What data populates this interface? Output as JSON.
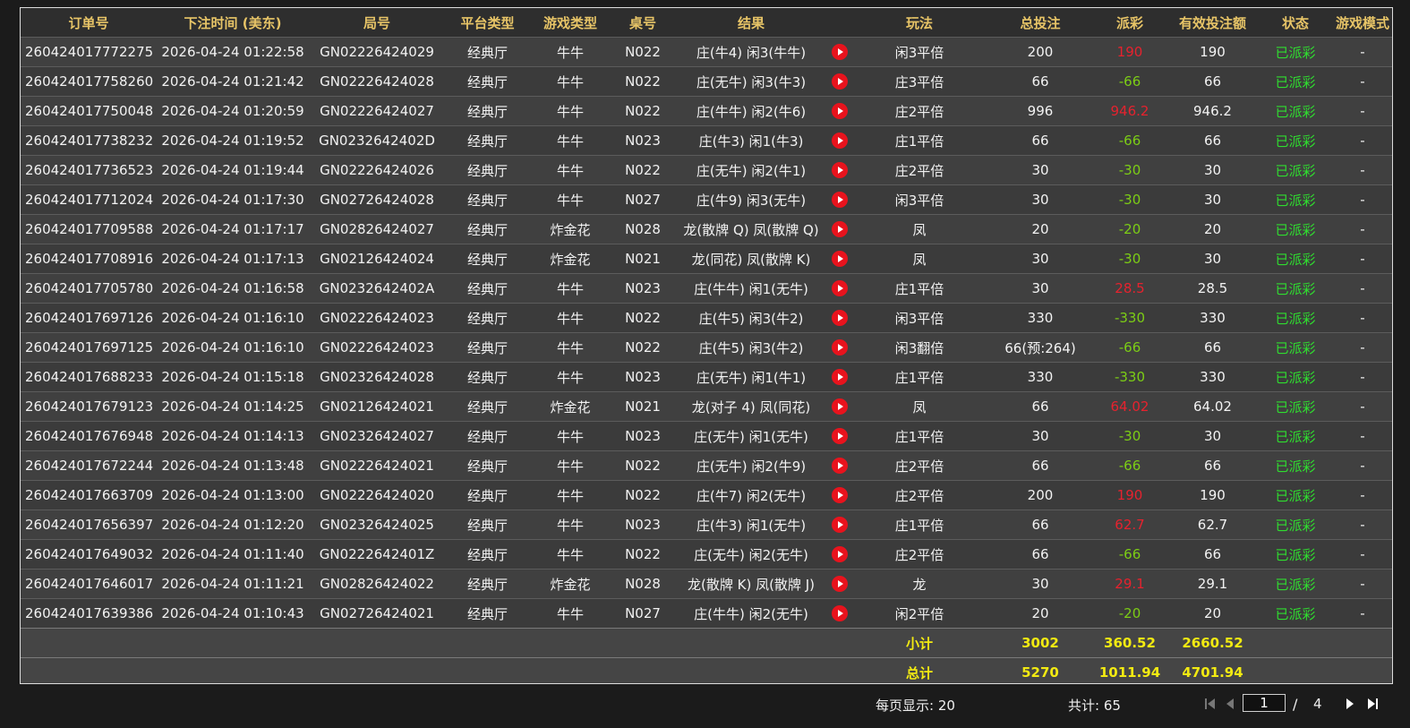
{
  "columns": [
    "订单号",
    "下注时间 (美东)",
    "局号",
    "平台类型",
    "游戏类型",
    "桌号",
    "结果",
    "",
    "玩法",
    "总投注",
    "派彩",
    "有效投注额",
    "状态",
    "游戏模式"
  ],
  "rows": [
    {
      "order": "260424017772275",
      "time": "2026-04-24 01:22:58",
      "round": "GN02226424029",
      "platform": "经典厅",
      "game": "牛牛",
      "table": "N022",
      "result": "庄(牛4) 闲3(牛牛)",
      "play": "闲3平倍",
      "bet": "200",
      "payout": "190",
      "payout_type": "win",
      "valid": "190",
      "status": "已派彩",
      "mode": "-"
    },
    {
      "order": "260424017758260",
      "time": "2026-04-24 01:21:42",
      "round": "GN02226424028",
      "platform": "经典厅",
      "game": "牛牛",
      "table": "N022",
      "result": "庄(无牛) 闲3(牛3)",
      "play": "庄3平倍",
      "bet": "66",
      "payout": "-66",
      "payout_type": "lose",
      "valid": "66",
      "status": "已派彩",
      "mode": "-"
    },
    {
      "order": "260424017750048",
      "time": "2026-04-24 01:20:59",
      "round": "GN02226424027",
      "platform": "经典厅",
      "game": "牛牛",
      "table": "N022",
      "result": "庄(牛牛) 闲2(牛6)",
      "play": "庄2平倍",
      "bet": "996",
      "payout": "946.2",
      "payout_type": "win",
      "valid": "946.2",
      "status": "已派彩",
      "mode": "-"
    },
    {
      "order": "260424017738232",
      "time": "2026-04-24 01:19:52",
      "round": "GN0232642402D",
      "platform": "经典厅",
      "game": "牛牛",
      "table": "N023",
      "result": "庄(牛3) 闲1(牛3)",
      "play": "庄1平倍",
      "bet": "66",
      "payout": "-66",
      "payout_type": "lose",
      "valid": "66",
      "status": "已派彩",
      "mode": "-"
    },
    {
      "order": "260424017736523",
      "time": "2026-04-24 01:19:44",
      "round": "GN02226424026",
      "platform": "经典厅",
      "game": "牛牛",
      "table": "N022",
      "result": "庄(无牛) 闲2(牛1)",
      "play": "庄2平倍",
      "bet": "30",
      "payout": "-30",
      "payout_type": "lose",
      "valid": "30",
      "status": "已派彩",
      "mode": "-"
    },
    {
      "order": "260424017712024",
      "time": "2026-04-24 01:17:30",
      "round": "GN02726424028",
      "platform": "经典厅",
      "game": "牛牛",
      "table": "N027",
      "result": "庄(牛9) 闲3(无牛)",
      "play": "闲3平倍",
      "bet": "30",
      "payout": "-30",
      "payout_type": "lose",
      "valid": "30",
      "status": "已派彩",
      "mode": "-"
    },
    {
      "order": "260424017709588",
      "time": "2026-04-24 01:17:17",
      "round": "GN02826424027",
      "platform": "经典厅",
      "game": "炸金花",
      "table": "N028",
      "result": "龙(散牌 Q) 凤(散牌 Q)",
      "play": "凤",
      "bet": "20",
      "payout": "-20",
      "payout_type": "lose",
      "valid": "20",
      "status": "已派彩",
      "mode": "-"
    },
    {
      "order": "260424017708916",
      "time": "2026-04-24 01:17:13",
      "round": "GN02126424024",
      "platform": "经典厅",
      "game": "炸金花",
      "table": "N021",
      "result": "龙(同花) 凤(散牌 K)",
      "play": "凤",
      "bet": "30",
      "payout": "-30",
      "payout_type": "lose",
      "valid": "30",
      "status": "已派彩",
      "mode": "-"
    },
    {
      "order": "260424017705780",
      "time": "2026-04-24 01:16:58",
      "round": "GN0232642402A",
      "platform": "经典厅",
      "game": "牛牛",
      "table": "N023",
      "result": "庄(牛牛) 闲1(无牛)",
      "play": "庄1平倍",
      "bet": "30",
      "payout": "28.5",
      "payout_type": "win",
      "valid": "28.5",
      "status": "已派彩",
      "mode": "-"
    },
    {
      "order": "260424017697126",
      "time": "2026-04-24 01:16:10",
      "round": "GN02226424023",
      "platform": "经典厅",
      "game": "牛牛",
      "table": "N022",
      "result": "庄(牛5) 闲3(牛2)",
      "play": "闲3平倍",
      "bet": "330",
      "payout": "-330",
      "payout_type": "lose",
      "valid": "330",
      "status": "已派彩",
      "mode": "-"
    },
    {
      "order": "260424017697125",
      "time": "2026-04-24 01:16:10",
      "round": "GN02226424023",
      "platform": "经典厅",
      "game": "牛牛",
      "table": "N022",
      "result": "庄(牛5) 闲3(牛2)",
      "play": "闲3翻倍",
      "bet": "66(预:264)",
      "payout": "-66",
      "payout_type": "lose",
      "valid": "66",
      "status": "已派彩",
      "mode": "-"
    },
    {
      "order": "260424017688233",
      "time": "2026-04-24 01:15:18",
      "round": "GN02326424028",
      "platform": "经典厅",
      "game": "牛牛",
      "table": "N023",
      "result": "庄(无牛) 闲1(牛1)",
      "play": "庄1平倍",
      "bet": "330",
      "payout": "-330",
      "payout_type": "lose",
      "valid": "330",
      "status": "已派彩",
      "mode": "-"
    },
    {
      "order": "260424017679123",
      "time": "2026-04-24 01:14:25",
      "round": "GN02126424021",
      "platform": "经典厅",
      "game": "炸金花",
      "table": "N021",
      "result": "龙(对子 4) 凤(同花)",
      "play": "凤",
      "bet": "66",
      "payout": "64.02",
      "payout_type": "win",
      "valid": "64.02",
      "status": "已派彩",
      "mode": "-"
    },
    {
      "order": "260424017676948",
      "time": "2026-04-24 01:14:13",
      "round": "GN02326424027",
      "platform": "经典厅",
      "game": "牛牛",
      "table": "N023",
      "result": "庄(无牛) 闲1(无牛)",
      "play": "庄1平倍",
      "bet": "30",
      "payout": "-30",
      "payout_type": "lose",
      "valid": "30",
      "status": "已派彩",
      "mode": "-"
    },
    {
      "order": "260424017672244",
      "time": "2026-04-24 01:13:48",
      "round": "GN02226424021",
      "platform": "经典厅",
      "game": "牛牛",
      "table": "N022",
      "result": "庄(无牛) 闲2(牛9)",
      "play": "庄2平倍",
      "bet": "66",
      "payout": "-66",
      "payout_type": "lose",
      "valid": "66",
      "status": "已派彩",
      "mode": "-"
    },
    {
      "order": "260424017663709",
      "time": "2026-04-24 01:13:00",
      "round": "GN02226424020",
      "platform": "经典厅",
      "game": "牛牛",
      "table": "N022",
      "result": "庄(牛7) 闲2(无牛)",
      "play": "庄2平倍",
      "bet": "200",
      "payout": "190",
      "payout_type": "win",
      "valid": "190",
      "status": "已派彩",
      "mode": "-"
    },
    {
      "order": "260424017656397",
      "time": "2026-04-24 01:12:20",
      "round": "GN02326424025",
      "platform": "经典厅",
      "game": "牛牛",
      "table": "N023",
      "result": "庄(牛3) 闲1(无牛)",
      "play": "庄1平倍",
      "bet": "66",
      "payout": "62.7",
      "payout_type": "win",
      "valid": "62.7",
      "status": "已派彩",
      "mode": "-"
    },
    {
      "order": "260424017649032",
      "time": "2026-04-24 01:11:40",
      "round": "GN0222642401Z",
      "platform": "经典厅",
      "game": "牛牛",
      "table": "N022",
      "result": "庄(无牛) 闲2(无牛)",
      "play": "庄2平倍",
      "bet": "66",
      "payout": "-66",
      "payout_type": "lose",
      "valid": "66",
      "status": "已派彩",
      "mode": "-"
    },
    {
      "order": "260424017646017",
      "time": "2026-04-24 01:11:21",
      "round": "GN02826424022",
      "platform": "经典厅",
      "game": "炸金花",
      "table": "N028",
      "result": "龙(散牌 K) 凤(散牌 J)",
      "play": "龙",
      "bet": "30",
      "payout": "29.1",
      "payout_type": "win",
      "valid": "29.1",
      "status": "已派彩",
      "mode": "-"
    },
    {
      "order": "260424017639386",
      "time": "2026-04-24 01:10:43",
      "round": "GN02726424021",
      "platform": "经典厅",
      "game": "牛牛",
      "table": "N027",
      "result": "庄(牛牛) 闲2(无牛)",
      "play": "闲2平倍",
      "bet": "20",
      "payout": "-20",
      "payout_type": "lose",
      "valid": "20",
      "status": "已派彩",
      "mode": "-"
    }
  ],
  "subtotal": {
    "label": "小计",
    "bet": "3002",
    "payout": "360.52",
    "valid": "2660.52"
  },
  "total": {
    "label": "总计",
    "bet": "5270",
    "payout": "1011.94",
    "valid": "4701.94"
  },
  "pagination": {
    "per_page_label": "每页显示: 20",
    "total_label": "共计: 65",
    "current_page": "1",
    "separator": "/",
    "total_pages": "4"
  },
  "icons": {
    "replay": "play-circle-icon",
    "first": "first-page-icon",
    "prev": "prev-page-icon",
    "next": "next-page-icon",
    "last": "last-page-icon"
  },
  "colors": {
    "header_text": "#e7c467",
    "win": "#e6222e",
    "lose": "#7ccd15",
    "status": "#2fdd2f",
    "summary": "#f2ea12"
  }
}
